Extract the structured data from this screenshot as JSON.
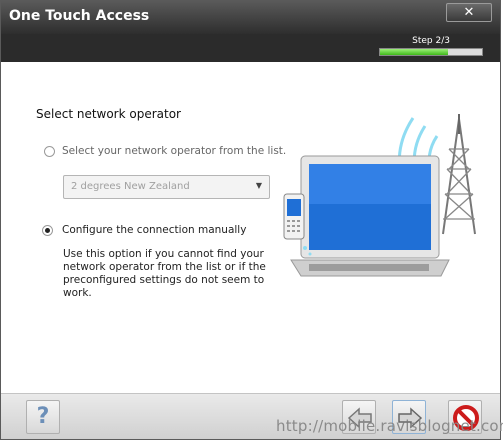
{
  "window": {
    "title": "One Touch Access",
    "close_glyph": "✕"
  },
  "wizard": {
    "step_label": "Step 2/3",
    "progress": 0.6667
  },
  "main": {
    "heading": "Select network operator",
    "option_list": {
      "label": "Select your network operator from the list.",
      "selected": false
    },
    "operator_select": {
      "value": "2 degrees New Zealand"
    },
    "option_manual": {
      "label": "Configure the connection manually",
      "selected": true
    },
    "manual_description": "Use this option if you cannot find your network operator from the list or if the preconfigured settings do not seem to work."
  },
  "footer": {
    "help_glyph": "?",
    "buttons": {
      "help": "help-icon",
      "back": "back-arrow-icon",
      "next": "next-arrow-icon",
      "cancel": "cancel-icon"
    }
  },
  "watermark": "http://mobile.ravisblognet.com",
  "colors": {
    "titlebar": "#3a3a3a",
    "progress": "#4cc424",
    "wave": "#8fdcf2",
    "screen": "#1f6fd6"
  }
}
